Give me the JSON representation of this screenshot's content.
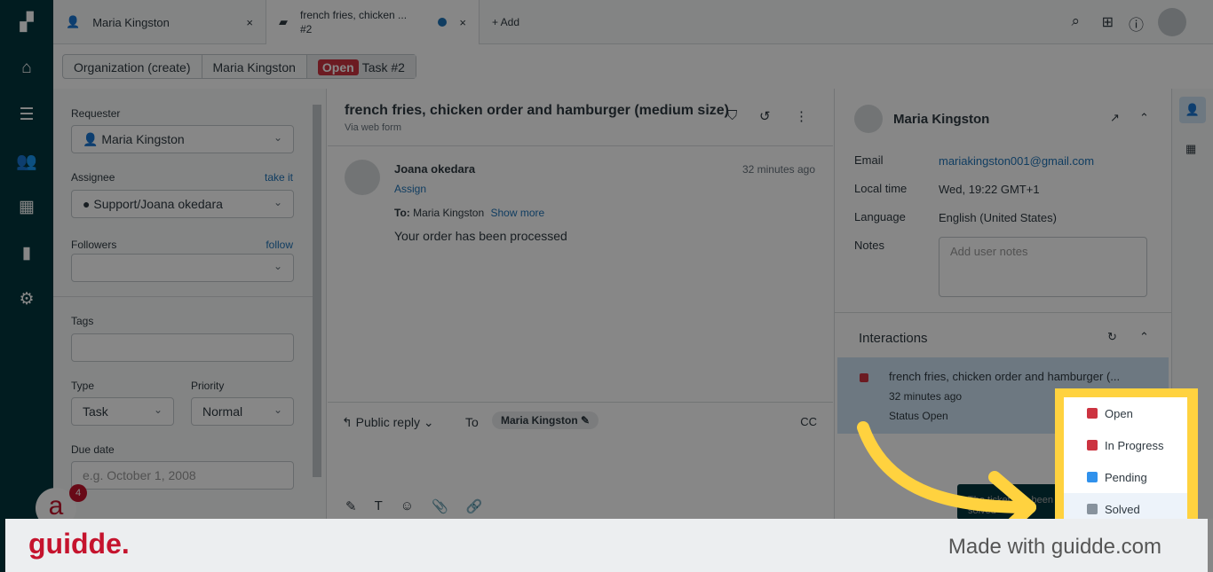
{
  "tabs": [
    {
      "label": "Maria Kingston"
    },
    {
      "label": "french fries, chicken ...",
      "sub": "#2"
    }
  ],
  "add_tab": "+ Add",
  "breadcrumbs": {
    "org": "Organization (create)",
    "user": "Maria Kingston",
    "status": "Open",
    "task": "Task #2"
  },
  "left": {
    "requester_label": "Requester",
    "requester": "Maria Kingston",
    "assignee_label": "Assignee",
    "take_it": "take it",
    "assignee": "Support/Joana okedara",
    "followers_label": "Followers",
    "follow": "follow",
    "tags_label": "Tags",
    "type_label": "Type",
    "type": "Task",
    "priority_label": "Priority",
    "priority": "Normal",
    "due_label": "Due date",
    "due_placeholder": "e.g. October 1, 2008",
    "notif_count": "4"
  },
  "ticket": {
    "title": "french fries, chicken order and hamburger (medium size)",
    "via": "Via web form",
    "author": "Joana okedara",
    "time": "32 minutes ago",
    "assign": "Assign",
    "to_label": "To:",
    "to": "Maria Kingston",
    "show_more": "Show more",
    "body": "Your order has been processed",
    "reply_mode": "Public reply",
    "to2": "To",
    "recipient": "Maria Kingston",
    "cc": "CC"
  },
  "user": {
    "name": "Maria Kingston",
    "email_label": "Email",
    "email": "mariakingston001@gmail.com",
    "time_label": "Local time",
    "time": "Wed, 19:22 GMT+1",
    "lang_label": "Language",
    "lang": "English (United States)",
    "notes_label": "Notes",
    "notes_placeholder": "Add user notes"
  },
  "interactions": {
    "title": "Interactions",
    "item_title": "french fries, chicken order and hamburger (...",
    "item_time": "32 minutes ago",
    "item_status": "Status Open"
  },
  "tooltip": "The ticket has been solved",
  "status_options": [
    {
      "label": "Open",
      "color": "#cc3340"
    },
    {
      "label": "In Progress",
      "color": "#cc3340"
    },
    {
      "label": "Pending",
      "color": "#3091ec"
    },
    {
      "label": "Solved",
      "color": "#87929d"
    }
  ],
  "banner": {
    "logo": "guidde.",
    "text": "Made with guidde.com"
  },
  "colors": {
    "highlight": "#ffd23f",
    "brand": "#c5132d"
  }
}
